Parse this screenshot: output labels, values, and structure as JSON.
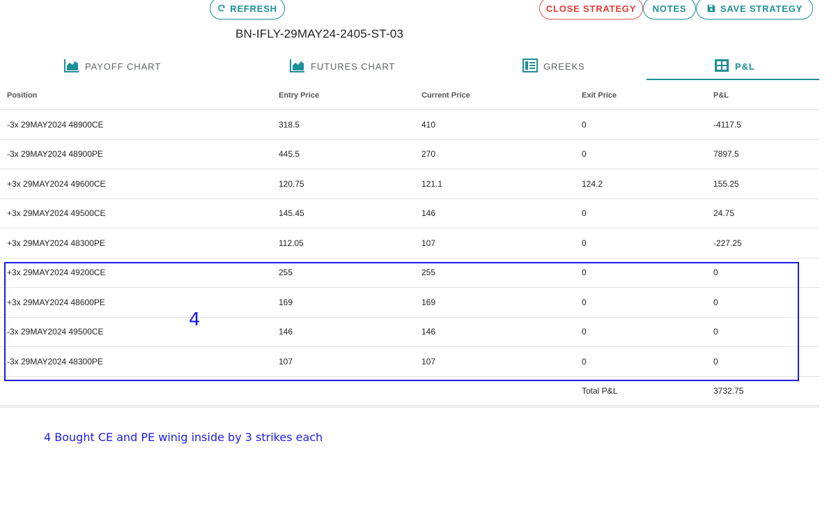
{
  "toolbar": {
    "refresh_label": "REFRESH",
    "close_label": "CLOSE STRATEGY",
    "notes_label": "NOTES",
    "save_label": "SAVE STRATEGY"
  },
  "strategy_name": "BN-IFLY-29MAY24-2405-ST-03",
  "tabs": [
    {
      "label": "PAYOFF CHART",
      "icon": "area-chart-icon",
      "active": false
    },
    {
      "label": "FUTURES CHART",
      "icon": "area-chart-icon",
      "active": false
    },
    {
      "label": "GREEKS",
      "icon": "table-icon",
      "active": false
    },
    {
      "label": "P&L",
      "icon": "grid-icon",
      "active": true
    }
  ],
  "table": {
    "headers": [
      "Position",
      "Entry Price",
      "Current Price",
      "Exit Price",
      "P&L"
    ],
    "rows": [
      [
        "-3x 29MAY2024 48900CE",
        "318.5",
        "410",
        "0",
        "-4117.5"
      ],
      [
        "-3x 29MAY2024 48900PE",
        "445.5",
        "270",
        "0",
        "7897.5"
      ],
      [
        "+3x 29MAY2024 49600CE",
        "120.75",
        "121.1",
        "124.2",
        "155.25"
      ],
      [
        "+3x 29MAY2024 49500CE",
        "145.45",
        "146",
        "0",
        "24.75"
      ],
      [
        "+3x 29MAY2024 48300PE",
        "112.05",
        "107",
        "0",
        "-227.25"
      ],
      [
        "+3x 29MAY2024 49200CE",
        "255",
        "255",
        "0",
        "0"
      ],
      [
        "+3x 29MAY2024 48600PE",
        "169",
        "169",
        "0",
        "0"
      ],
      [
        "-3x 29MAY2024 49500CE",
        "146",
        "146",
        "0",
        "0"
      ],
      [
        "-3x 29MAY2024 48300PE",
        "107",
        "107",
        "0",
        "0"
      ]
    ],
    "total_label": "Total P&L",
    "total_value": "3732.75"
  },
  "annotation": {
    "number": "4",
    "note": "4 Bought CE and PE winig inside by 3 strikes each"
  },
  "colors": {
    "accent": "#1d8f99",
    "danger": "#e53935",
    "annotation": "#1c1ce6"
  }
}
